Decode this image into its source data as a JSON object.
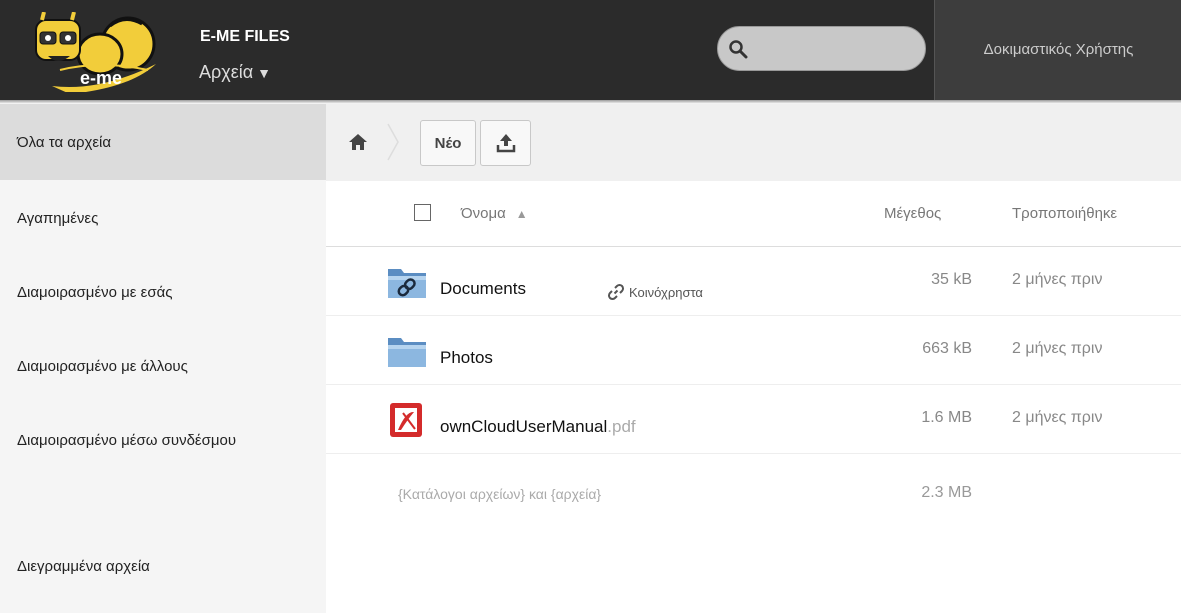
{
  "header": {
    "logo_text": "e-me",
    "app_title": "E-ME FILES",
    "app_menu": "Αρχεία",
    "app_menu_caret": "▼",
    "search": {
      "value": "",
      "placeholder": ""
    },
    "user_name": "Δοκιμαστικός Χρήστης"
  },
  "sidebar": {
    "items": [
      {
        "label": "Όλα τα αρχεία",
        "active": true
      },
      {
        "label": "Αγαπημένες"
      },
      {
        "label": "Διαμοιρασμένο με εσάς"
      },
      {
        "label": "Διαμοιρασμένο με άλλους"
      },
      {
        "label": "Διαμοιρασμένο μέσω συνδέσμου"
      },
      {
        "label": "Διεγραμμένα αρχεία"
      }
    ]
  },
  "controls": {
    "new_label": "Νέο",
    "upload_icon": "upload-icon",
    "home_icon": "home-icon"
  },
  "table": {
    "columns": {
      "name": "Όνομα",
      "name_sort": "▲",
      "size": "Μέγεθος",
      "modified": "Τροποποιήθηκε"
    },
    "rows": [
      {
        "name": "Documents",
        "ext": "",
        "icon": "shared-folder-icon",
        "share": "Κοινόχρηστα",
        "size": "35 kB",
        "modified": "2 μήνες πριν"
      },
      {
        "name": "Photos",
        "ext": "",
        "icon": "folder-icon",
        "share": "",
        "size": "663 kB",
        "modified": "2 μήνες πριν"
      },
      {
        "name": "ownCloudUserManual",
        "ext": ".pdf",
        "icon": "pdf-icon",
        "share": "",
        "size": "1.6 MB",
        "modified": "2 μήνες πριν"
      }
    ],
    "summary": {
      "text": "{Κατάλογοι αρχείων} και {αρχεία}",
      "size": "2.3 MB"
    }
  },
  "colors": {
    "header_bg": "#2b2b2b",
    "user_bg": "#3d3d3d",
    "sidebar_bg": "#f5f5f5",
    "active_bg": "#dcdcdc",
    "logo_yellow": "#f2cd3a",
    "pdf_red": "#d42b2b"
  }
}
